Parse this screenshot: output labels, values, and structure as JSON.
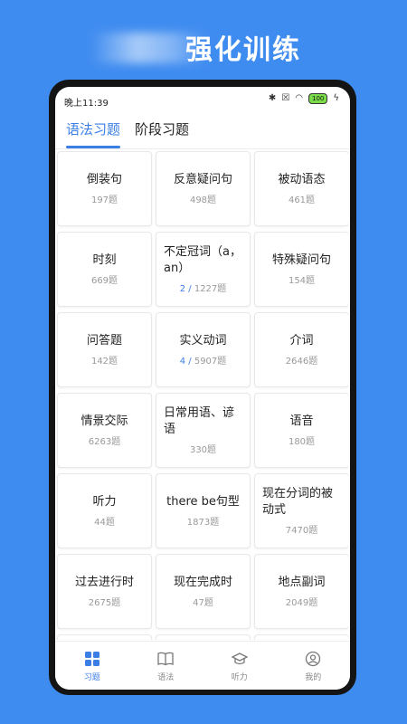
{
  "headline": "强化训练",
  "status": {
    "time": "晚上11:39",
    "battery": "100"
  },
  "tabs": [
    {
      "label": "语法习题",
      "active": true
    },
    {
      "label": "阶段习题",
      "active": false
    }
  ],
  "exercises": [
    {
      "title": "倒装句",
      "count": "197题"
    },
    {
      "title": "反意疑问句",
      "count": "498题"
    },
    {
      "title": "被动语态",
      "count": "461题"
    },
    {
      "title": "时刻",
      "count": "669题"
    },
    {
      "title": "不定冠词（a，an）",
      "done": "2",
      "sep": " / ",
      "count": "1227题"
    },
    {
      "title": "特殊疑问句",
      "count": "154题"
    },
    {
      "title": "问答题",
      "count": "142题"
    },
    {
      "title": "实义动词",
      "done": "4",
      "sep": " / ",
      "count": "5907题"
    },
    {
      "title": "介词",
      "count": "2646题"
    },
    {
      "title": "情景交际",
      "count": "6263题"
    },
    {
      "title": "日常用语、谚语",
      "count": "330题"
    },
    {
      "title": "语音",
      "count": "180题"
    },
    {
      "title": "听力",
      "count": "44题"
    },
    {
      "title": "there be句型",
      "count": "1873题"
    },
    {
      "title": "现在分词的被动式",
      "count": "7470题"
    },
    {
      "title": "过去进行时",
      "count": "2675题"
    },
    {
      "title": "现在完成时",
      "count": "47题"
    },
    {
      "title": "地点副词",
      "count": "2049题"
    }
  ],
  "nav": [
    {
      "label": "习题",
      "icon": "grid-icon",
      "active": true
    },
    {
      "label": "语法",
      "icon": "book-icon",
      "active": false
    },
    {
      "label": "听力",
      "icon": "graduation-cap-icon",
      "active": false
    },
    {
      "label": "我的",
      "icon": "user-icon",
      "active": false
    }
  ],
  "colors": {
    "background": "#3f8cf0",
    "accent": "#3b7fe6"
  }
}
